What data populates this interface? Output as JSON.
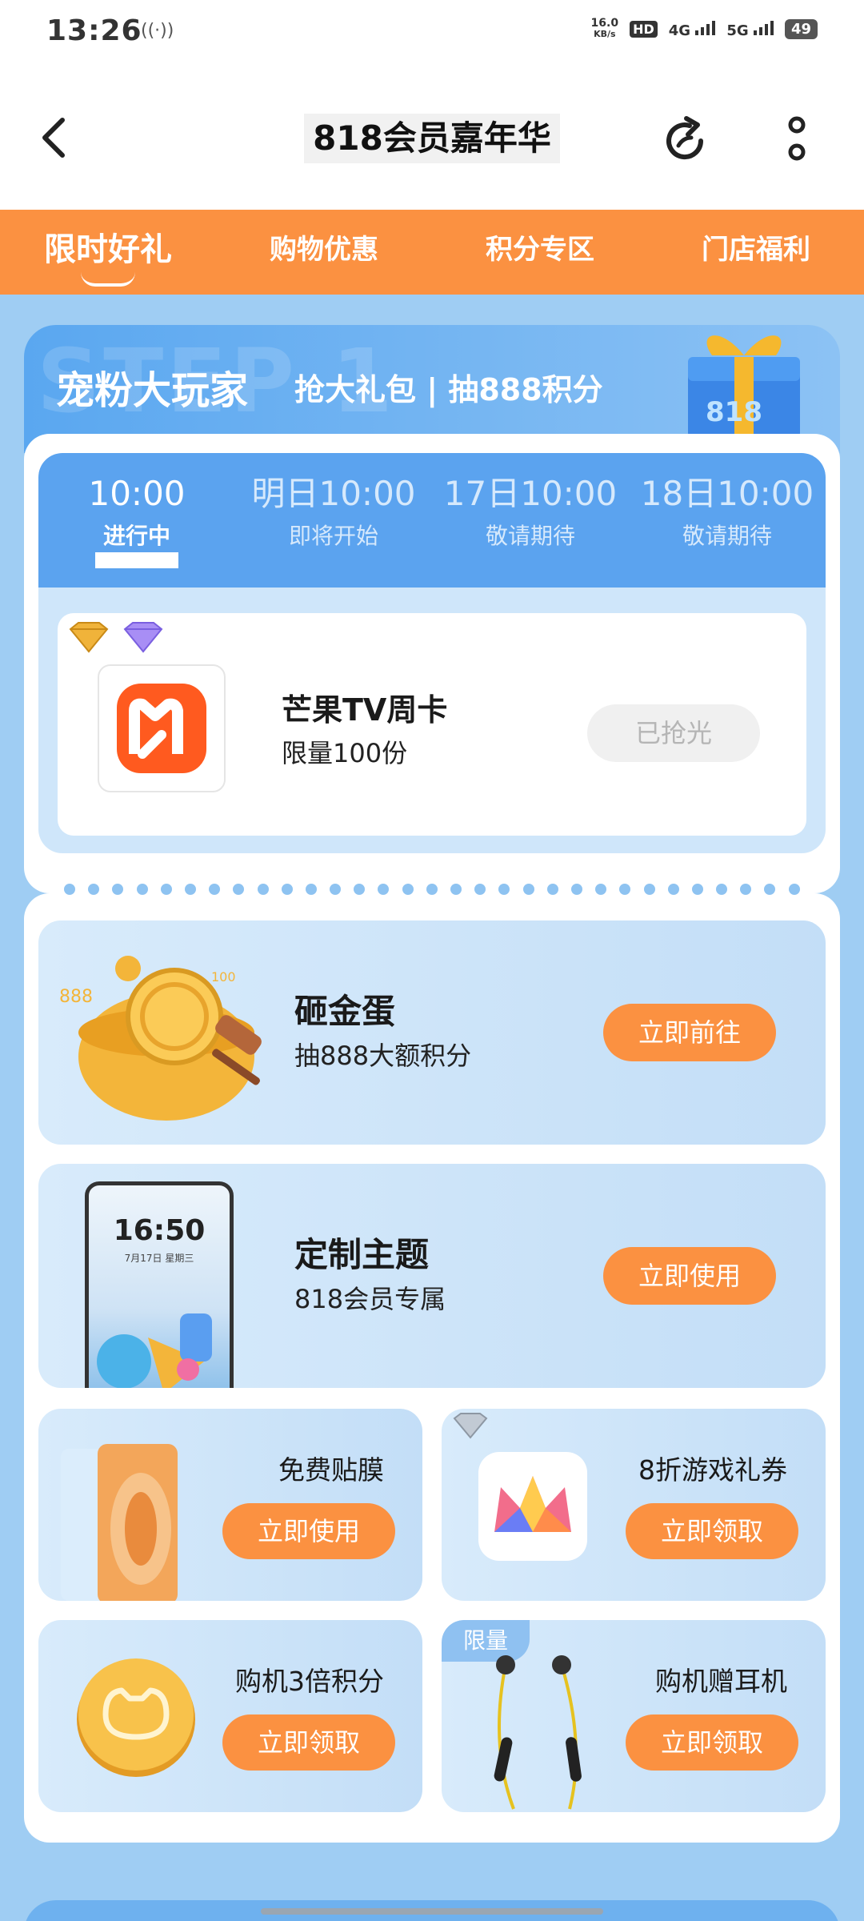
{
  "status_bar": {
    "time": "13:26",
    "net_speed_value": "16.0",
    "net_speed_unit": "KB/s",
    "hd_label": "HD",
    "sim1": "4G",
    "sim2": "5G",
    "battery": "49"
  },
  "header": {
    "title": "818会员嘉年华"
  },
  "tabs": [
    {
      "label": "限时好礼",
      "active": true
    },
    {
      "label": "购物优惠",
      "active": false
    },
    {
      "label": "积分专区",
      "active": false
    },
    {
      "label": "门店福利",
      "active": false
    }
  ],
  "step_section": {
    "watermark": "STEP 1",
    "title": "宠粉大玩家",
    "subtitle": "抢大礼包 | 抽888积分",
    "sessions": [
      {
        "time": "10:00",
        "status": "进行中",
        "active": true
      },
      {
        "time": "明日10:00",
        "status": "即将开始",
        "active": false
      },
      {
        "time": "17日10:00",
        "status": "敬请期待",
        "active": false
      },
      {
        "time": "18日10:00",
        "status": "敬请期待",
        "active": false
      }
    ],
    "prize": {
      "name": "芒果TV周卡",
      "quantity": "限量100份",
      "button": "已抢光"
    }
  },
  "activities": {
    "egg": {
      "title": "砸金蛋",
      "subtitle": "抽888大额积分",
      "button": "立即前往",
      "deco_label": "888",
      "deco_label_2": "100"
    },
    "theme": {
      "title": "定制主题",
      "subtitle": "818会员专属",
      "button": "立即使用",
      "phone_time": "16:50",
      "phone_date": "7月17日 星期三"
    },
    "film": {
      "title": "免费贴膜",
      "button": "立即使用"
    },
    "game": {
      "title": "8折游戏礼券",
      "button": "立即领取"
    },
    "points": {
      "title": "购机3倍积分",
      "button": "立即领取"
    },
    "earphones": {
      "tag": "限量",
      "title": "购机赠耳机",
      "button": "立即领取"
    }
  },
  "colors": {
    "accent_orange": "#fb9141",
    "primary_blue": "#5ba3ef",
    "page_bg": "#9fcdf3"
  }
}
